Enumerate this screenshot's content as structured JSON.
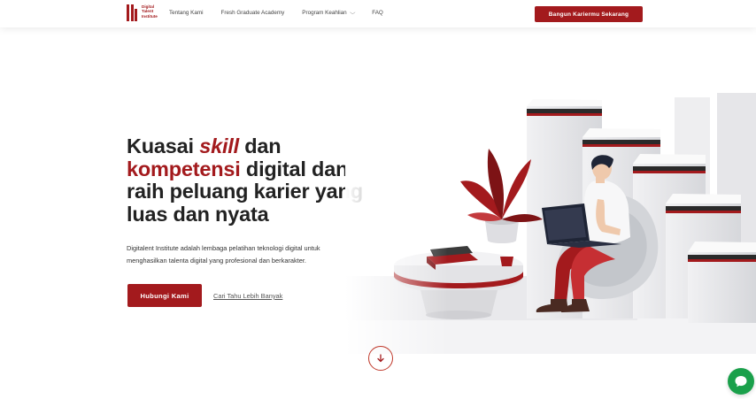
{
  "navbar": {
    "logo_lines": [
      "Digital",
      "Talent",
      "Institute"
    ],
    "links": [
      "Tentang Kami",
      "Fresh Graduate Academy",
      "Program Keahlian",
      "FAQ"
    ],
    "cta": "Bangun Kariermu Sekarang"
  },
  "hero": {
    "title_part1": "Kuasai ",
    "title_em": "skill",
    "title_part2": " dan",
    "title_accent": "kompetensi",
    "title_part3": " digital dan raih peluang karier yang luas dan nyata",
    "description": "Digitalent Institute adalah lembaga pelatihan teknologi digital untuk menghasilkan talenta digital yang profesional dan berkarakter.",
    "primary_button": "Hubungi Kami",
    "secondary_link": "Cari Tahu Lebih Banyak"
  },
  "icons": {
    "scroll": "arrow-down-icon",
    "chat": "chat-icon",
    "dropdown": "chevron-down-icon"
  },
  "colors": {
    "brand": "#a31a1d",
    "chat": "#1aa04b"
  }
}
